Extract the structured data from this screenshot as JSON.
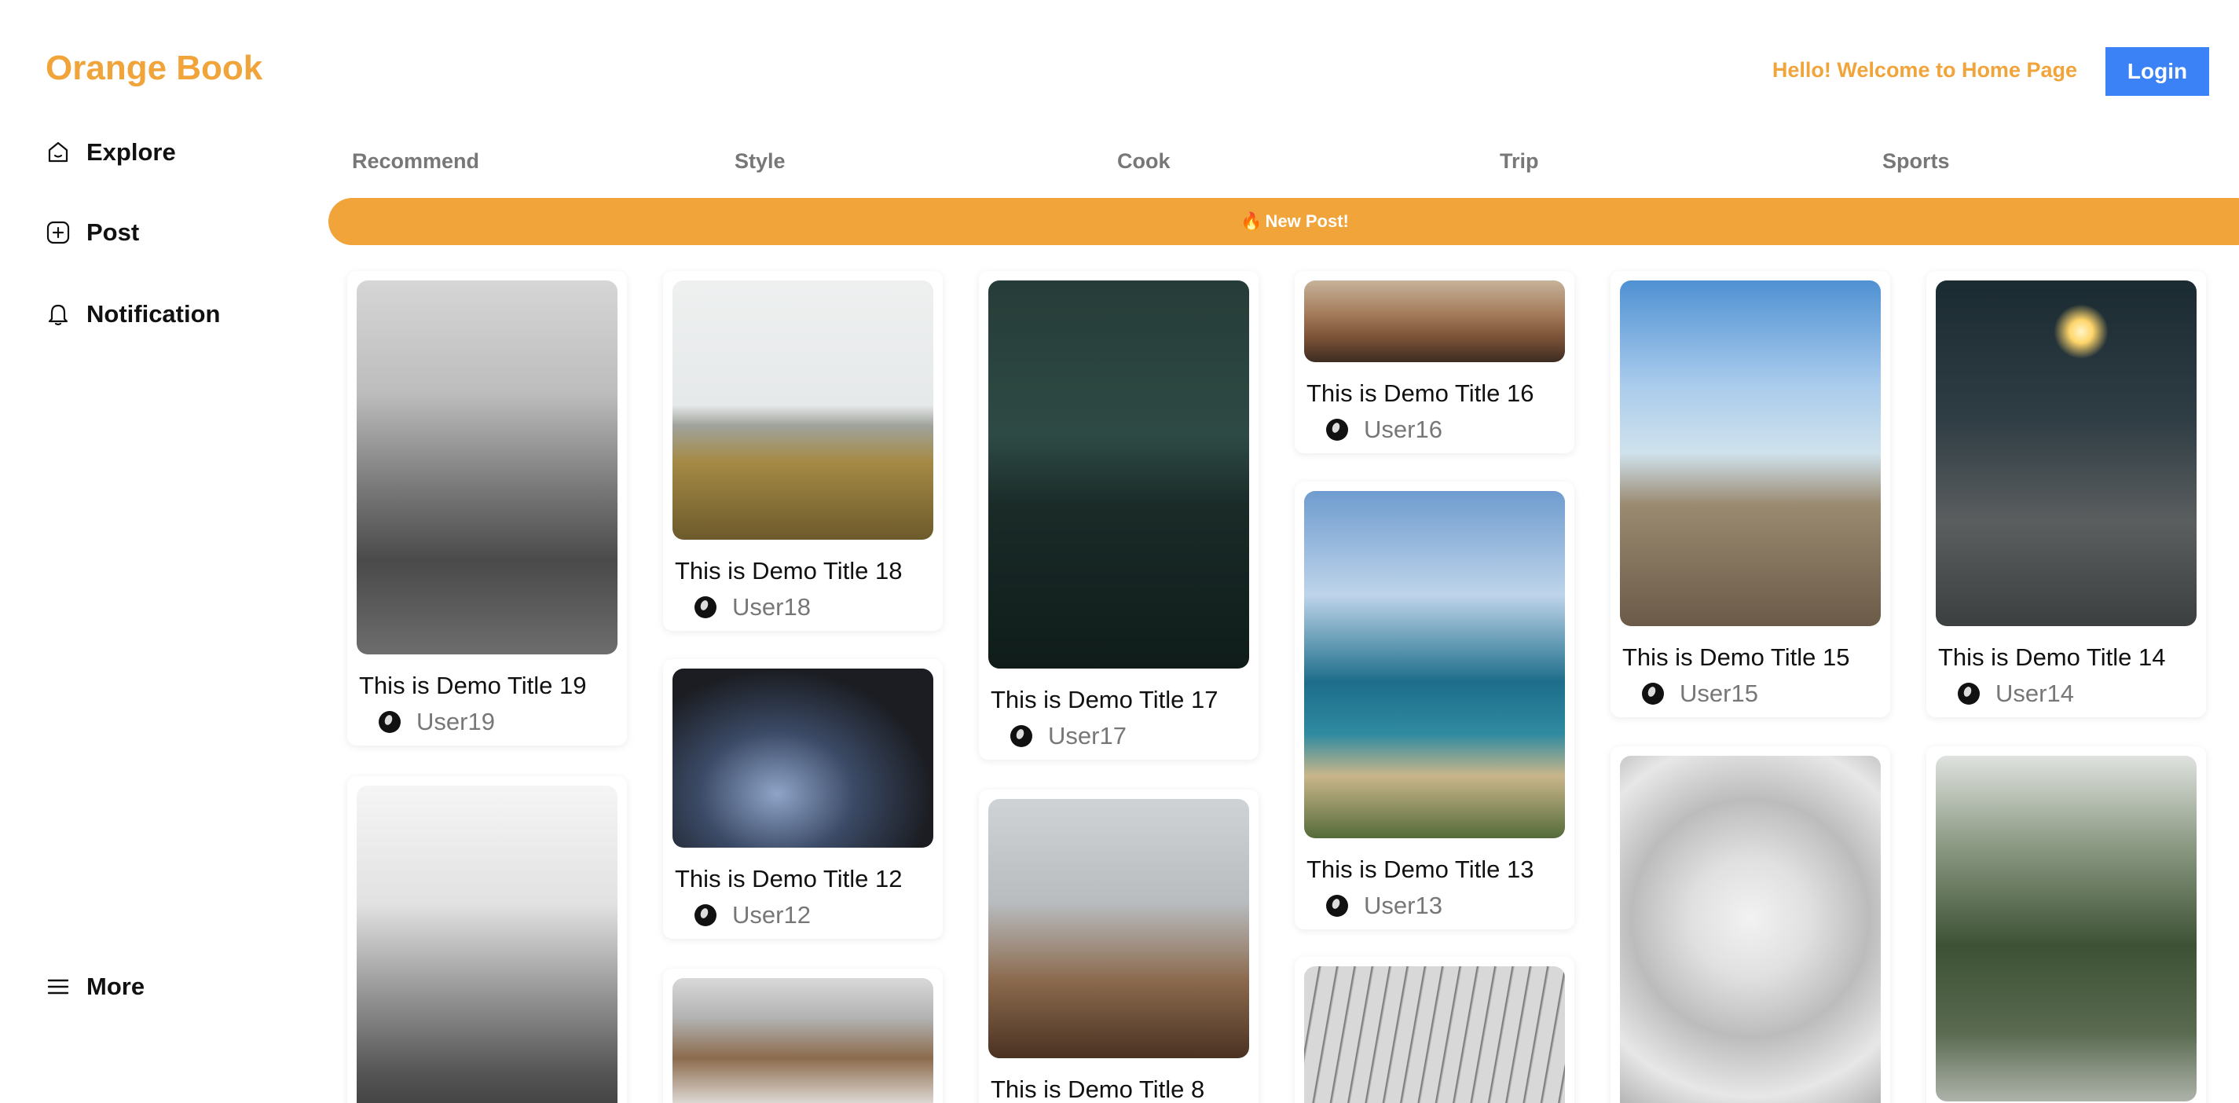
{
  "app": {
    "logo": "Orange Book"
  },
  "header": {
    "welcome": "Hello! Welcome to Home Page",
    "login_label": "Login"
  },
  "sidebar": {
    "items": [
      {
        "label": "Explore",
        "icon": "home-icon"
      },
      {
        "label": "Post",
        "icon": "plus-square-icon"
      },
      {
        "label": "Notification",
        "icon": "bell-icon"
      }
    ],
    "more": {
      "label": "More",
      "icon": "menu-icon"
    }
  },
  "tabs": [
    "Recommend",
    "Style",
    "Cook",
    "Trip",
    "Sports"
  ],
  "banner": {
    "icon": "🔥",
    "text": "New Post!"
  },
  "colors": {
    "accent": "#f0a43a",
    "login": "#3b82f6",
    "muted": "#777777"
  },
  "posts": [
    {
      "title": "This is Demo Title 19",
      "user": "User19",
      "image": "misty-forest"
    },
    {
      "title": "This is Demo Title 18",
      "user": "User18",
      "image": "beach-grass"
    },
    {
      "title": "This is Demo Title 17",
      "user": "User17",
      "image": "night-city-bridge"
    },
    {
      "title": "This is Demo Title 16",
      "user": "User16",
      "image": "desk-tools"
    },
    {
      "title": "This is Demo Title 15",
      "user": "User15",
      "image": "pier"
    },
    {
      "title": "This is Demo Title 14",
      "user": "User14",
      "image": "sparkler"
    },
    {
      "title": "This is Demo Title 12",
      "user": "User12",
      "image": "couple-night"
    },
    {
      "title": "This is Demo Title 13",
      "user": "User13",
      "image": "coast"
    },
    {
      "title": "This is Demo Title 8",
      "user": "",
      "image": "speaker-desk"
    },
    {
      "title": "",
      "user": "",
      "image": "city-skyline"
    },
    {
      "title": "",
      "user": "",
      "image": "workspace"
    },
    {
      "title": "",
      "user": "",
      "image": "bridge-cables"
    },
    {
      "title": "",
      "user": "",
      "image": "dome-ceiling"
    },
    {
      "title": "",
      "user": "",
      "image": "tree-road"
    }
  ]
}
